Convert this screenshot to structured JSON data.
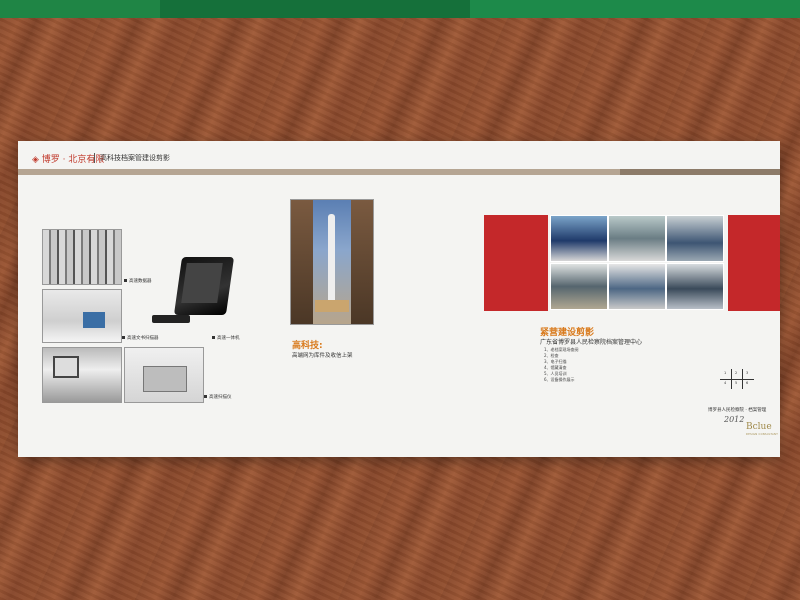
{
  "colors": {
    "top_bar": "#1a7a3a",
    "accent_red": "#c4282a",
    "accent_orange": "#d97b1e",
    "paper": "#f4f4f2"
  },
  "header": {
    "logo_text": "博罗 · 北京有限",
    "title": "高科技档案管建设剪影"
  },
  "left_page": {
    "captions": {
      "rack": "高速数据器",
      "scan_machine": "高速文书扫描器",
      "all_in_one": "高速一体机",
      "scanner": "高速扫描仪"
    }
  },
  "middle_page": {
    "heading": "高科技:",
    "subheading": "高端网为库件及收信上架"
  },
  "right_page": {
    "heading": "紧营建设剪影",
    "subheading": "广东省博罗县人民检察院档案管理中心",
    "list": [
      "1、老档案现场查阅",
      "2、检查",
      "3、电子扫描",
      "4、馆藏清查",
      "5、人员培训",
      "6、设备操作展示"
    ],
    "seal_chars": [
      "1",
      "2",
      "3",
      "4",
      "5",
      "6"
    ],
    "credit": "博罗县人民检察院 · 档案管理",
    "signature": "2012",
    "brand": "Bclue",
    "brand_sub": "DESIGN CONSULTANT"
  },
  "icons": [
    "logo-mark-icon",
    "bullet-icon"
  ]
}
